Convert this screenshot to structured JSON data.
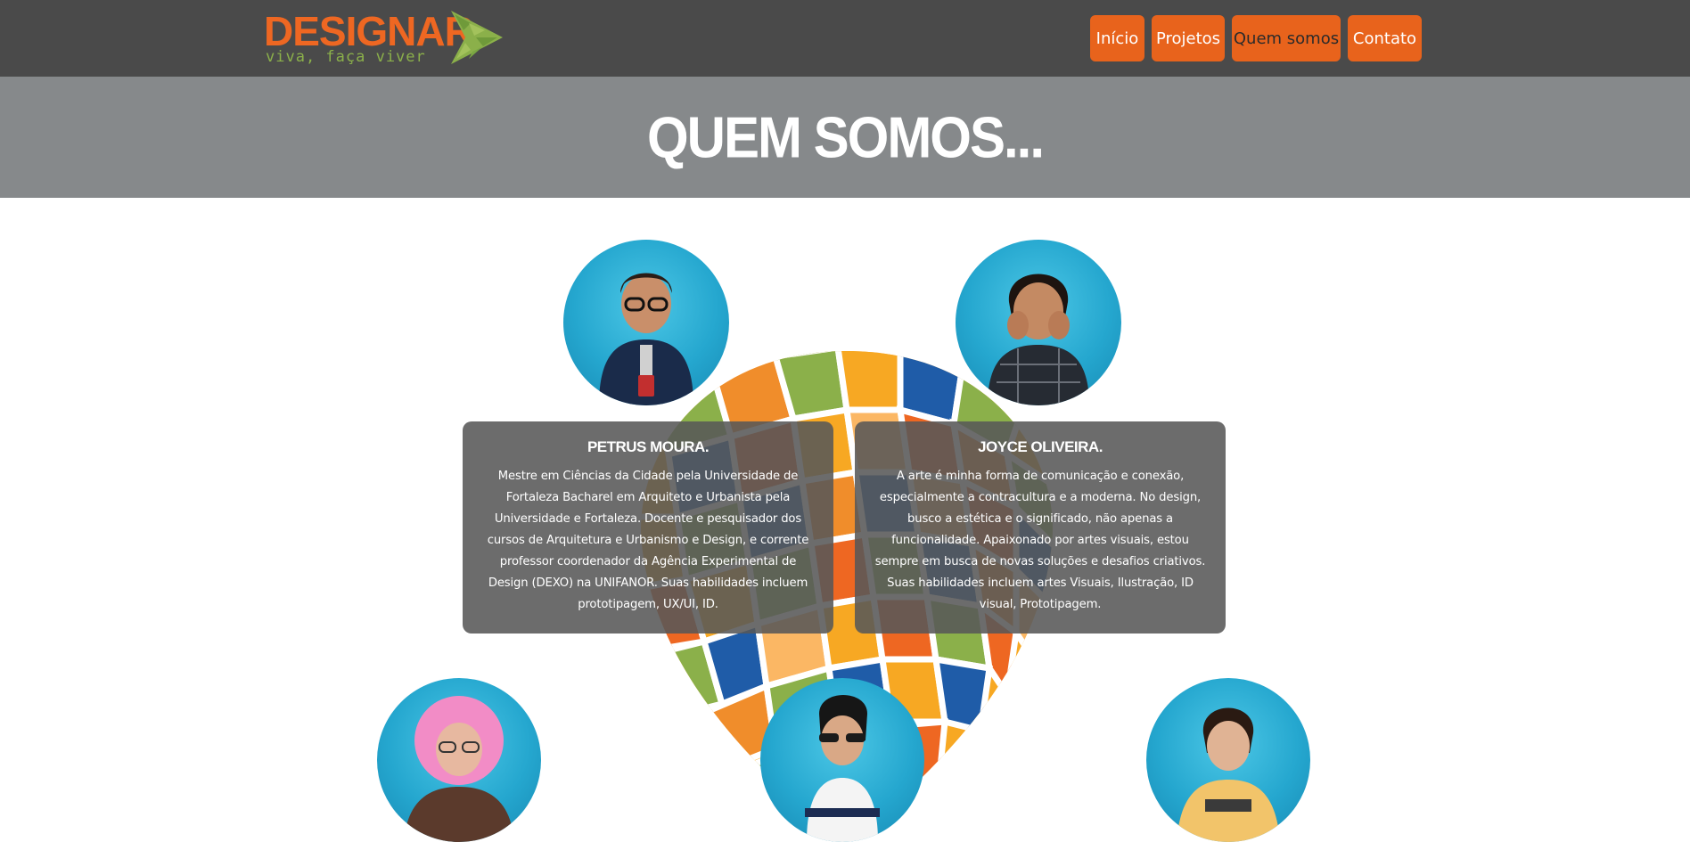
{
  "brand": {
    "name": "DESIGNAR",
    "tagline": "viva, faça viver",
    "colors": {
      "orange": "#ee6722",
      "green": "#8bb04a",
      "header_bg": "#4a4a4a",
      "band_bg": "#86898b"
    }
  },
  "nav": {
    "items": [
      {
        "label": "Início"
      },
      {
        "label": "Projetos"
      },
      {
        "label": "Quem somos"
      },
      {
        "label": "Contato"
      }
    ]
  },
  "page": {
    "title": "QUEM SOMOS..."
  },
  "team": [
    {
      "name": "PETRUS MOURA.",
      "bio": "Mestre em Ciências da Cidade pela Universidade de Fortaleza Bacharel em Arquiteto e Urbanista pela Universidade e Fortaleza. Docente e pesquisador dos cursos de Arquitetura e Urbanismo e Design, e corrente professor coordenador da Agência Experimental de Design (DEXO) na UNIFANOR. Suas habilidades incluem prototipagem, UX/UI, ID."
    },
    {
      "name": "JOYCE OLIVEIRA.",
      "bio": "A arte é minha forma de comunicação e conexão, especialmente a contracultura e a moderna. No design, busco a estética e o significado, não apenas a funcionalidade. Apaixonado por artes visuais, estou sempre em busca de novas soluções e desafios criativos. Suas habilidades incluem artes Visuais, Ilustração, ID visual, Prototipagem."
    }
  ],
  "icons": [
    "logo-arrow-icon",
    "team-photo-avatar",
    "mosaic-heart-graphic"
  ]
}
